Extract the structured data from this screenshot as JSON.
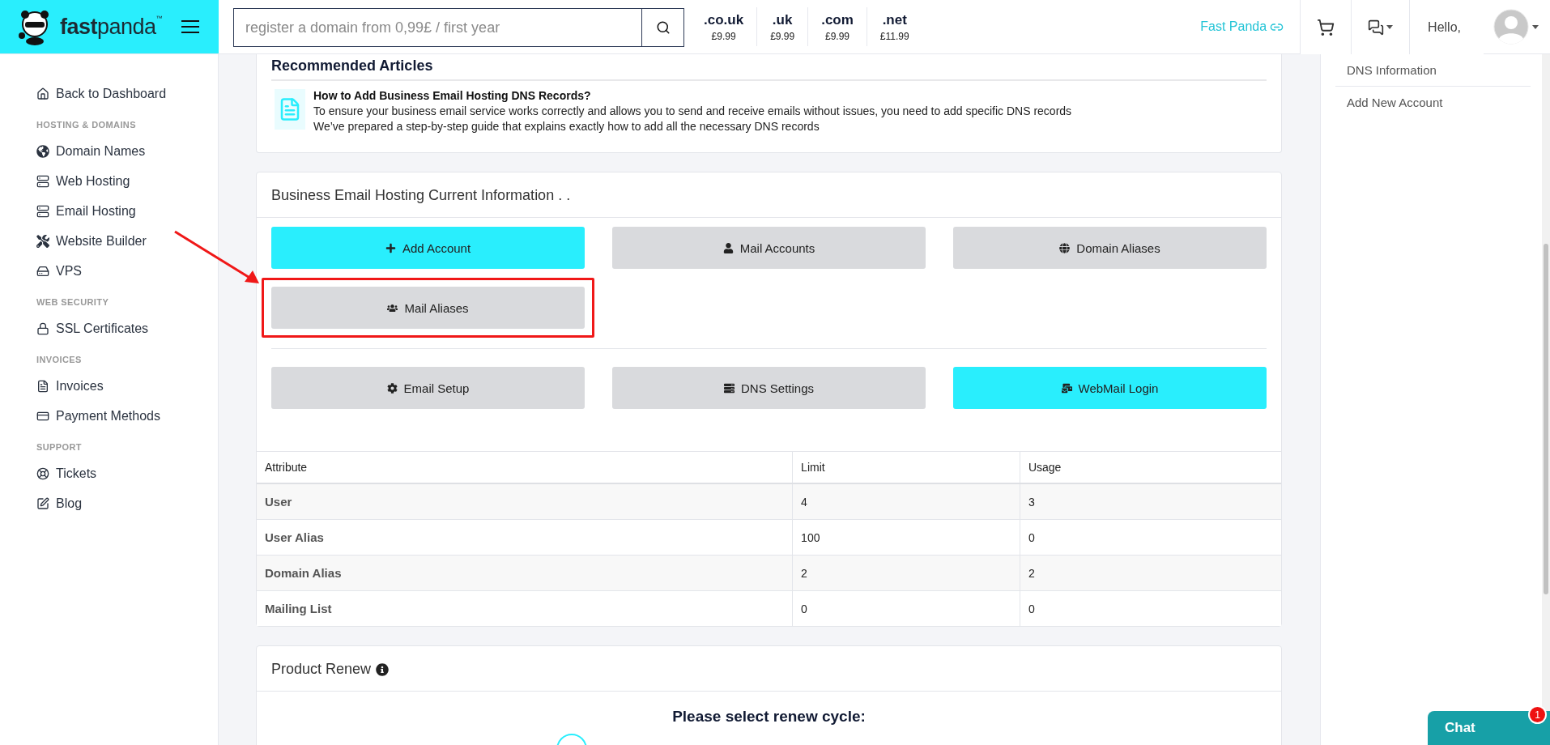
{
  "header": {
    "logo": "**fast**panda$^{™}$",
    "search": {
      "placeholder": "register a domain from 0,99£ / first year"
    },
    "domains": [
      {
        "tld": ".co.uk",
        "price": "£9.99"
      },
      {
        "tld": ".uk",
        "price": "£9.99"
      },
      {
        "tld": ".com",
        "price": "£9.99"
      },
      {
        "tld": ".net",
        "price": "£11.99"
      }
    ],
    "account_link": "Fast Panda",
    "greeting": "Hello,"
  },
  "sidebar": {
    "back_link": "Back to Dashboard",
    "sections": [
      {
        "heading": "HOSTING & DOMAINS",
        "items": [
          "Domain Names",
          "Web Hosting",
          "Email Hosting",
          "Website Builder",
          "VPS"
        ]
      },
      {
        "heading": "WEB SECURITY",
        "items": [
          "SSL Certificates"
        ]
      },
      {
        "heading": "INVOICES",
        "items": [
          "Invoices",
          "Payment Methods"
        ]
      },
      {
        "heading": "SUPPORT",
        "items": [
          "Tickets",
          "Blog"
        ]
      }
    ]
  },
  "articles": {
    "title": "Recommended Articles",
    "items": [
      {
        "title": "How to Add Business Email Hosting DNS Records?",
        "lines": [
          "To ensure your business email service works correctly and allows you to send and receive emails without issues, you need to add specific DNS records",
          "We’ve prepared a step-by-step guide that explains exactly how to add all the necessary DNS records"
        ]
      }
    ]
  },
  "email_info": {
    "title": "Business Email Hosting Current Information . .",
    "button_groups": [
      {
        "buttons": [
          {
            "label": "Add Account",
            "kind": "add",
            "primary": true,
            "annotated": false
          },
          {
            "label": "Mail Accounts",
            "kind": "user",
            "primary": false,
            "annotated": false
          },
          {
            "label": "Domain Aliases",
            "kind": "globe",
            "primary": false,
            "annotated": false
          },
          {
            "label": "Mail Aliases",
            "kind": "users",
            "primary": false,
            "annotated": true
          }
        ]
      },
      {
        "buttons": [
          {
            "label": "Email Setup",
            "kind": "gear",
            "primary": false,
            "annotated": false
          },
          {
            "label": "DNS Settings",
            "kind": "server",
            "primary": false,
            "annotated": false
          },
          {
            "label": "WebMail Login",
            "kind": "mail",
            "primary": true,
            "annotated": false
          }
        ]
      }
    ],
    "table": {
      "columns": [
        "Attribute",
        "Limit",
        "Usage"
      ],
      "rows": [
        [
          "User",
          "4",
          "3"
        ],
        [
          "User Alias",
          "100",
          "0"
        ],
        [
          "Domain Alias",
          "2",
          "2"
        ],
        [
          "Mailing List",
          "0",
          "0"
        ]
      ]
    }
  },
  "renew": {
    "title": "Product Renew",
    "prompt": "Please select renew cycle:",
    "option": {
      "selected": false
    }
  },
  "right_panel": {
    "items": [
      "DNS Information",
      "Add New Account"
    ]
  },
  "chat": {
    "label": "Chat",
    "badge": "1"
  }
}
